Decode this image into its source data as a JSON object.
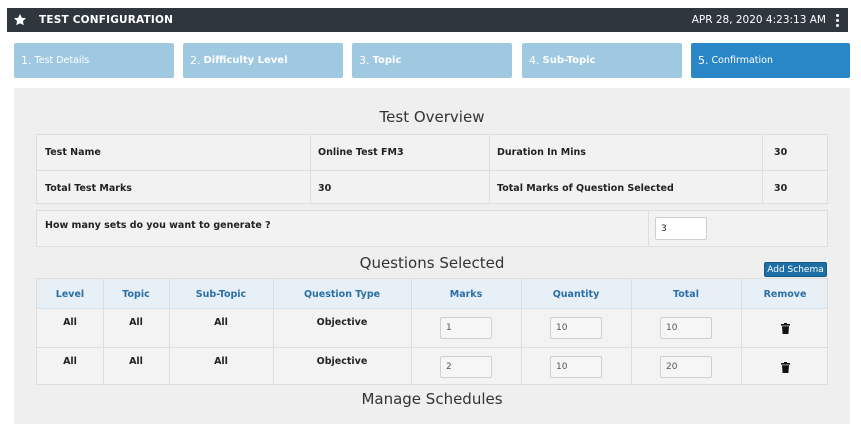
{
  "header": {
    "title": "TEST CONFIGURATION",
    "datetime": "APR 28, 2020  4:23:13 AM"
  },
  "steps": [
    {
      "num": "1.",
      "label": "Test Details"
    },
    {
      "num": "2.",
      "label": "Difficulty Level"
    },
    {
      "num": "3.",
      "label": "Topic"
    },
    {
      "num": "4.",
      "label": "Sub-Topic"
    },
    {
      "num": "5.",
      "label": "Confirmation"
    }
  ],
  "active_step": 5,
  "overview": {
    "title": "Test Overview",
    "test_name_label": "Test Name",
    "test_name_value": "Online Test FM3",
    "duration_label": "Duration In Mins",
    "duration_value": "30",
    "total_marks_label": "Total Test Marks",
    "total_marks_value": "30",
    "selected_marks_label": "Total Marks of Question Selected",
    "selected_marks_value": "30"
  },
  "sets": {
    "question": "How many sets do you want to generate ?",
    "value": "3"
  },
  "questions": {
    "title": "Questions Selected",
    "add_schema_label": "Add Schema",
    "columns": [
      "Level",
      "Topic",
      "Sub-Topic",
      "Question Type",
      "Marks",
      "Quantity",
      "Total",
      "Remove"
    ],
    "rows": [
      {
        "level": "All",
        "topic": "All",
        "subtopic": "All",
        "type": "Objective",
        "marks": "1",
        "quantity": "10",
        "total": "10"
      },
      {
        "level": "All",
        "topic": "All",
        "subtopic": "All",
        "type": "Objective",
        "marks": "2",
        "quantity": "10",
        "total": "20"
      }
    ]
  },
  "schedules": {
    "title": "Manage Schedules"
  },
  "colors": {
    "header_bg": "#2f363e",
    "step_bg": "#9fc9e0",
    "step_active_bg": "#2a87c7",
    "panel_bg": "#efefef",
    "column_header_text": "#2a6fa6",
    "add_schema_bg": "#1d6fa5"
  },
  "icons": {
    "header": "star-icon",
    "menu": "kebab-menu-icon",
    "remove": "trash-icon"
  }
}
